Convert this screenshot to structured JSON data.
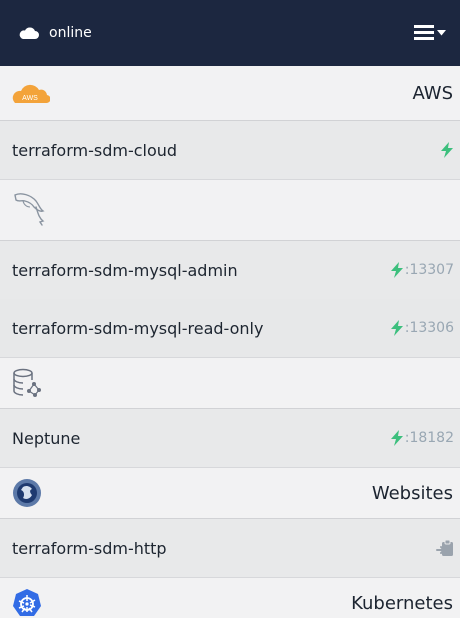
{
  "header": {
    "status": "online",
    "icons": {
      "status": "cloud-icon",
      "menu": "hamburger-menu-icon"
    }
  },
  "groups": [
    {
      "name": "AWS",
      "icon": "aws-cloud-icon",
      "items": [
        {
          "name": "terraform-sdm-cloud",
          "port": "",
          "action_icon": "lightning-icon"
        }
      ]
    },
    {
      "name": "",
      "icon": "mysql-dolphin-icon",
      "items": [
        {
          "name": "terraform-sdm-mysql-admin",
          "port": ":13307",
          "action_icon": "lightning-icon"
        },
        {
          "name": "terraform-sdm-mysql-read-only",
          "port": ":13306",
          "action_icon": "lightning-icon"
        }
      ]
    },
    {
      "name": "",
      "icon": "database-graph-icon",
      "items": [
        {
          "name": "Neptune",
          "port": ":18182",
          "action_icon": "lightning-icon"
        }
      ]
    },
    {
      "name": "Websites",
      "icon": "globe-icon",
      "items": [
        {
          "name": "terraform-sdm-http",
          "port": "",
          "action_icon": "clipboard-icon"
        }
      ]
    },
    {
      "name": "Kubernetes",
      "icon": "kubernetes-icon",
      "items": []
    }
  ],
  "colors": {
    "header_bg": "#1c2740",
    "accent_green": "#3cbf7d",
    "port_gray": "#99a7b3",
    "aws_orange": "#f3a33a",
    "kubernetes_blue": "#326ce5"
  }
}
